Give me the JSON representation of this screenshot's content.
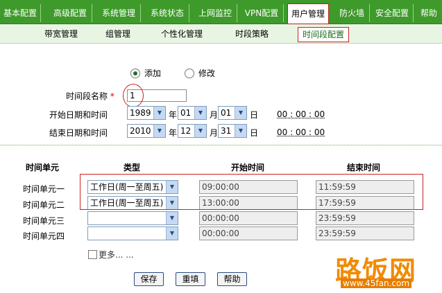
{
  "top_tabs": [
    "基本配置",
    "高级配置",
    "系统管理",
    "系统状态",
    "上网监控",
    "VPN配置",
    "用户管理",
    "防火墙",
    "安全配置",
    "帮助"
  ],
  "active_top_tab": "用户管理",
  "sub_tabs": [
    "带宽管理",
    "组管理",
    "个性化管理",
    "时段策略",
    "时间段配置"
  ],
  "active_sub_tab": "时间段配置",
  "mode": {
    "add_label": "添加",
    "edit_label": "修改",
    "selected": "添加"
  },
  "form": {
    "name_label": "时间段名称",
    "required_mark": "*",
    "name_value": "1",
    "start_label": "开始日期和时间",
    "end_label": "结束日期和时间",
    "year_unit": "年",
    "month_unit": "月",
    "day_unit": "日",
    "start": {
      "year": "1989",
      "month": "01",
      "day": "01",
      "time": "00 : 00 : 00"
    },
    "end": {
      "year": "2010",
      "month": "12",
      "day": "31",
      "time": "00 : 00 : 00"
    }
  },
  "table": {
    "headers": [
      "时间单元",
      "类型",
      "开始时间",
      "结束时间"
    ],
    "rows": [
      {
        "unit": "时间单元一",
        "type": "工作日(周一至周五)",
        "start": "09:00:00",
        "end": "11:59:59"
      },
      {
        "unit": "时间单元二",
        "type": "工作日(周一至周五)",
        "start": "13:00:00",
        "end": "17:59:59"
      },
      {
        "unit": "时间单元三",
        "type": "",
        "start": "00:00:00",
        "end": "23:59:59"
      },
      {
        "unit": "时间单元四",
        "type": "",
        "start": "00:00:00",
        "end": "23:59:59"
      }
    ]
  },
  "more_label": "更多... ...",
  "buttons": {
    "save": "保存",
    "reset": "重填",
    "help": "帮助"
  },
  "watermark": {
    "text": "路饭网",
    "url": "www.45fan.com"
  },
  "colors": {
    "nav_green": "#3e9a2a",
    "highlight_red": "#cc2222"
  }
}
